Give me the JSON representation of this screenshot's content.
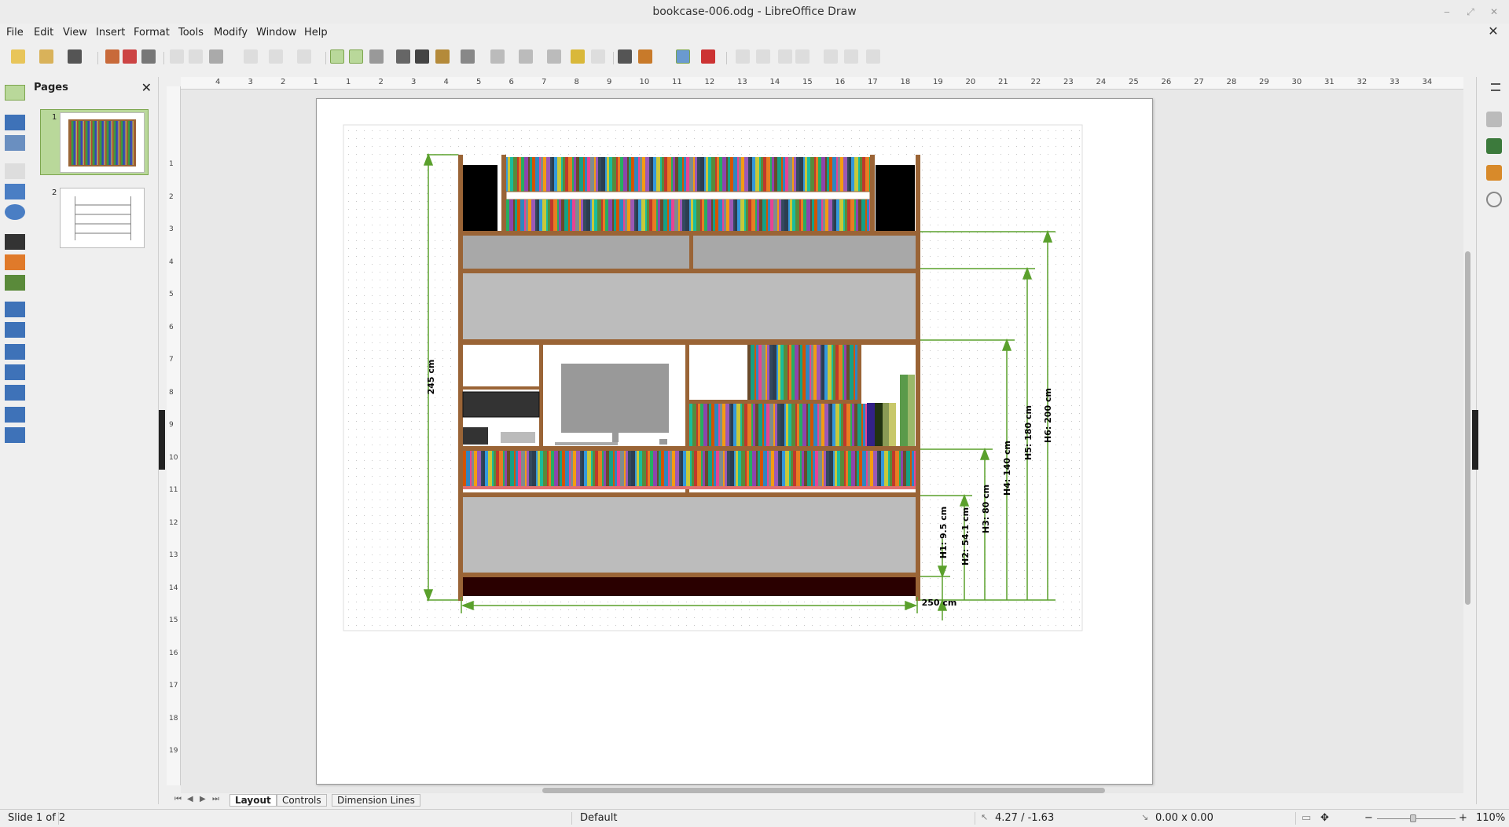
{
  "window": {
    "title": "bookcase-006.odg - LibreOffice Draw",
    "close_doc": "✕"
  },
  "menu": [
    "File",
    "Edit",
    "View",
    "Insert",
    "Format",
    "Tools",
    "Modify",
    "Window",
    "Help"
  ],
  "pages_panel": {
    "title": "Pages",
    "close": "✕",
    "page_numbers": [
      "1",
      "2"
    ]
  },
  "ruler": {
    "h_ticks": [
      "4",
      "3",
      "2",
      "1",
      "1",
      "2",
      "3",
      "4",
      "5",
      "6",
      "7",
      "8",
      "9",
      "10",
      "11",
      "12",
      "13",
      "14",
      "15",
      "16",
      "17",
      "18",
      "19",
      "20",
      "21",
      "22",
      "23",
      "24",
      "25",
      "26",
      "27",
      "28",
      "29",
      "30",
      "31",
      "32",
      "33",
      "34"
    ],
    "v_ticks": [
      "1",
      "2",
      "3",
      "4",
      "5",
      "6",
      "7",
      "8",
      "9",
      "10",
      "11",
      "12",
      "13",
      "14",
      "15",
      "16",
      "17",
      "18",
      "19"
    ]
  },
  "drawing": {
    "total_height_label": "245 cm",
    "width_label": "250 cm",
    "h1_label": "H1: 9.5 cm",
    "h2_label": "H2: 54.1 cm",
    "h3_label": "H3: 80 cm",
    "h4_label": "H4: 140 cm",
    "h5_label": "H5: 180 cm",
    "h6_label": "H6: 200 cm",
    "colors": {
      "wood": "#9a6436",
      "dimension": "#5aa02c",
      "panel_gray": "#b8b8b8",
      "plinth": "#2a0000"
    }
  },
  "sheet_tabs": [
    "Layout",
    "Controls",
    "Dimension Lines"
  ],
  "status": {
    "slide": "Slide 1 of 2",
    "layout": "Default",
    "position": "4.27 / -1.63",
    "size": "0.00 x 0.00",
    "zoom": "110%"
  }
}
